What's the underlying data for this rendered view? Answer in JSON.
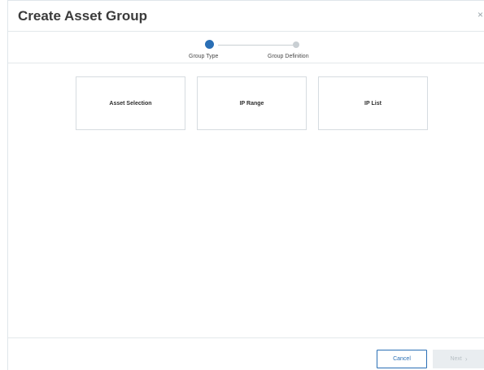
{
  "dialog": {
    "title": "Create Asset Group",
    "close_glyph": "×"
  },
  "stepper": {
    "steps": [
      {
        "label": "Group Type",
        "state": "active"
      },
      {
        "label": "Group Definition",
        "state": "inactive"
      }
    ]
  },
  "options": [
    {
      "label": "Asset Selection"
    },
    {
      "label": "IP Range"
    },
    {
      "label": "IP List"
    }
  ],
  "footer": {
    "cancel_label": "Cancel",
    "next_label": "Next",
    "next_glyph": "›"
  },
  "colors": {
    "accent": "#2a6fb5",
    "disabled_bg": "#e9edf0",
    "border": "#d6dce0"
  },
  "icons": {
    "close": "close-icon",
    "next": "chevron-right-icon"
  }
}
